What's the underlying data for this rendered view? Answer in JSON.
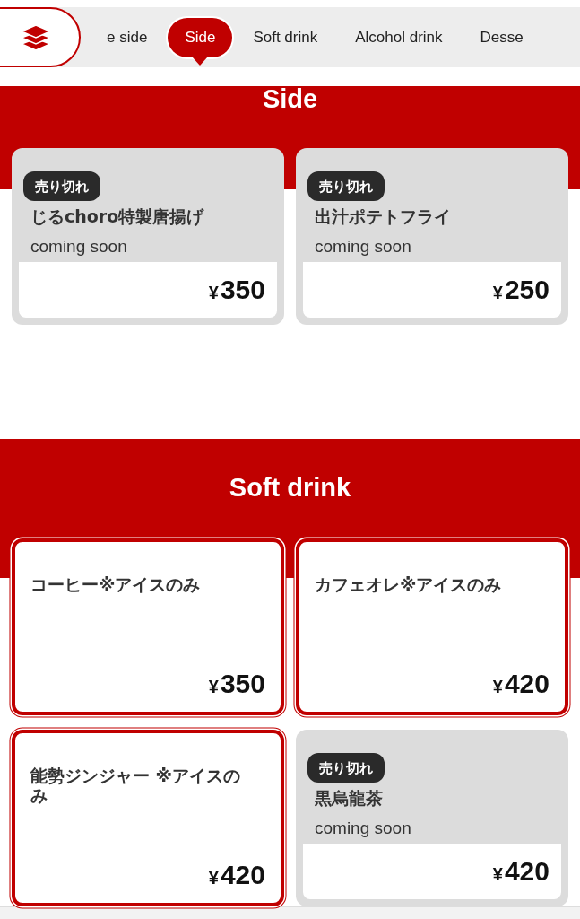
{
  "tabs": [
    {
      "label": "e side",
      "selected": false
    },
    {
      "label": "Side",
      "selected": true
    },
    {
      "label": "Soft drink",
      "selected": false
    },
    {
      "label": "Alcohol drink",
      "selected": false
    },
    {
      "label": "Desse",
      "selected": false
    }
  ],
  "sections": [
    {
      "title": "Side",
      "items": [
        {
          "name": "じるchoro特製唐揚げ",
          "sold_out": true,
          "badge": "売り切れ",
          "note": "coming soon",
          "price": "350",
          "currency": "¥"
        },
        {
          "name": "出汁ポテトフライ",
          "sold_out": true,
          "badge": "売り切れ",
          "note": "coming soon",
          "price": "250",
          "currency": "¥"
        }
      ]
    },
    {
      "title": "Soft drink",
      "items": [
        {
          "name": "コーヒー※アイスのみ",
          "sold_out": false,
          "price": "350",
          "currency": "¥"
        },
        {
          "name": "カフェオレ※アイスのみ",
          "sold_out": false,
          "price": "420",
          "currency": "¥"
        },
        {
          "name": "能勢ジンジャー ※アイスのみ",
          "sold_out": false,
          "price": "420",
          "currency": "¥"
        },
        {
          "name": "黒烏龍茶",
          "sold_out": true,
          "badge": "売り切れ",
          "note": "coming soon",
          "price": "420",
          "currency": "¥"
        }
      ]
    }
  ]
}
